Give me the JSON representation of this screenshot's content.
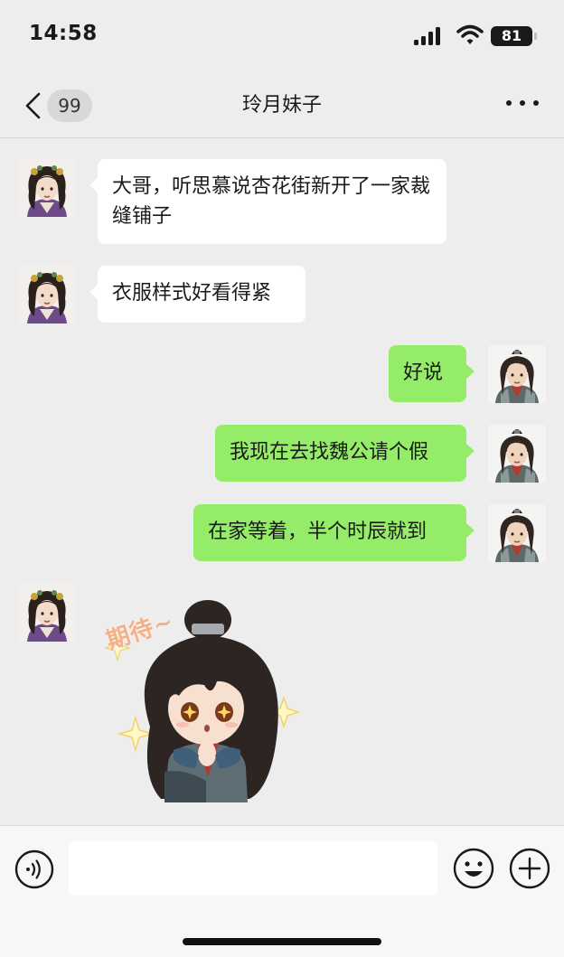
{
  "status_bar": {
    "time": "14:58",
    "battery": "81"
  },
  "nav": {
    "unread_count": "99",
    "title": "玲月妹子"
  },
  "messages": [
    {
      "side": "in",
      "text": "大哥，听思慕说杏花街新开了一家裁缝铺子"
    },
    {
      "side": "in",
      "text": "衣服样式好看得紧"
    },
    {
      "side": "out",
      "text": "好说"
    },
    {
      "side": "out",
      "text": "我现在去找魏公请个假"
    },
    {
      "side": "out",
      "text": "在家等着，半个时辰就到"
    }
  ],
  "sticker": {
    "caption": "期待~"
  },
  "input_bar": {
    "placeholder": ""
  },
  "colors": {
    "background": "#ededed",
    "incoming_bubble": "#ffffff",
    "outgoing_bubble": "#95ec69"
  }
}
